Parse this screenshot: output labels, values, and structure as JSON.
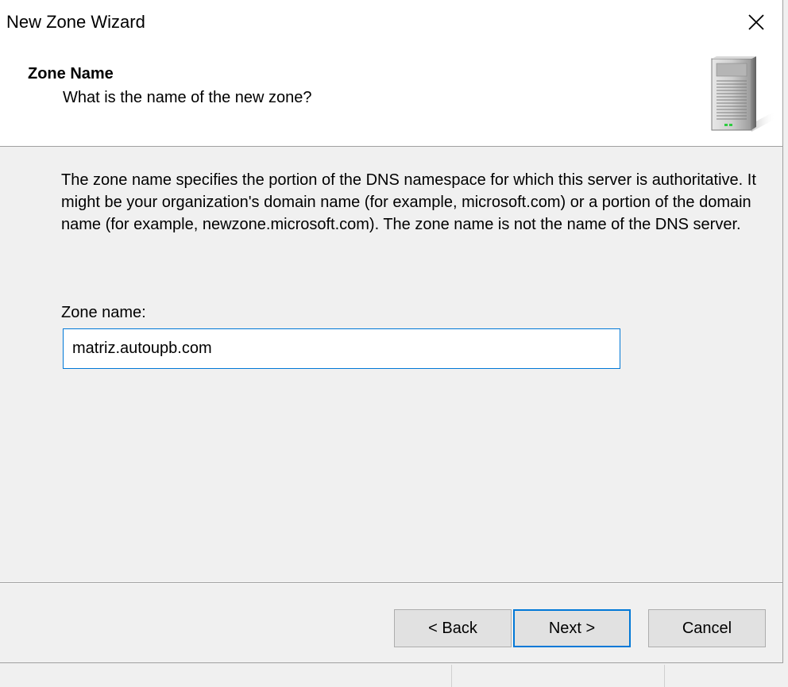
{
  "window": {
    "title": "New Zone Wizard",
    "close_glyph": "✕"
  },
  "header": {
    "title": "Zone Name",
    "subtitle": "What is the name of the new zone?",
    "icon": "server-icon"
  },
  "body": {
    "description": "The zone name specifies the portion of the DNS namespace for which this server is authoritative. It might be your organization's domain name (for example,  microsoft.com) or a portion of the domain name (for example, newzone.microsoft.com). The zone name is not the name of the DNS server.",
    "zone_name_label": "Zone name:",
    "zone_name_value": "matriz.autoupb.com"
  },
  "buttons": {
    "back": "< Back",
    "next": "Next >",
    "cancel": "Cancel"
  },
  "colors": {
    "accent": "#0078d7",
    "dialog_bg": "#f0f0f0",
    "header_bg": "#ffffff"
  }
}
